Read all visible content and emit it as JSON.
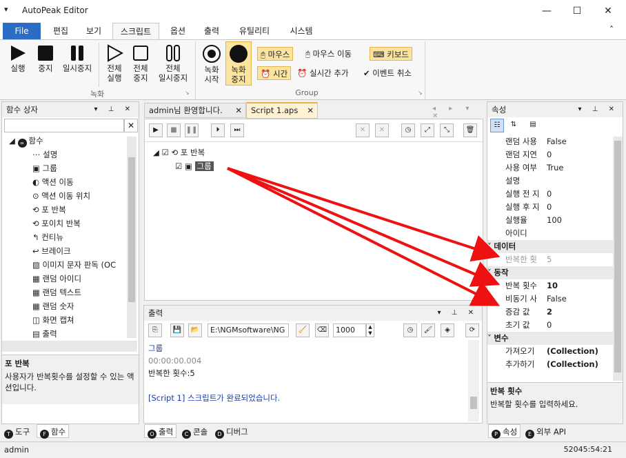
{
  "window": {
    "title": "AutoPeak Editor",
    "menu_icon": "▾",
    "min": "—",
    "max": "☐",
    "close": "✕"
  },
  "menu": {
    "file": "File",
    "tabs": [
      "편집",
      "보기",
      "스크립트",
      "옵션",
      "출력",
      "유틸리티",
      "시스템"
    ],
    "collapse": "˄"
  },
  "ribbon": {
    "run": "실행",
    "stop": "중지",
    "pause": "일시중지",
    "run_all": [
      "전체",
      "실행"
    ],
    "stop_all": [
      "전체",
      "중지"
    ],
    "pause_all": [
      "전체",
      "일시중지"
    ],
    "group1": "녹화",
    "rec_start": [
      "녹화",
      "시작"
    ],
    "rec_stop": [
      "녹화",
      "중지"
    ],
    "mouse": "마우스",
    "mouse_move": "마우스 이동",
    "keyboard": "키보드",
    "time": "시간",
    "realtime": "실시간 추가",
    "event_cancel": "이벤트 취소",
    "group2": "Group"
  },
  "func_panel": {
    "title": "함수 상자",
    "root": "함수",
    "items": [
      "설명",
      "그룹",
      "액션 이동",
      "액션 이동 위치",
      "포 반복",
      "포이치 반복",
      "컨티뉴",
      "브레이크",
      "이미지 문자 판독 (OC",
      "랜덤 아이디",
      "랜덤 텍스트",
      "랜덤 숫자",
      "화면 캡쳐",
      "출력"
    ],
    "desc_title": "포 반복",
    "desc": "사용자가 반복횟수를 설정할 수 있는 액션입니다.",
    "tab_tool": "도구",
    "tab_func": "함수"
  },
  "doc": {
    "tab_welcome": "admin님 환영합니다.",
    "tab_script": "Script 1.aps",
    "tree_loop": "포 반복",
    "tree_group": "그룹"
  },
  "output": {
    "title": "출력",
    "path": "E:\\NGMsoftware\\NG",
    "count": "1000",
    "lines": [
      "그룹",
      "00:00:00.004",
      "반복한 횟수:5",
      "",
      "[Script 1] 스크립트가 완료되었습니다."
    ],
    "tab_output": "출력",
    "tab_console": "콘솔",
    "tab_debug": "디버그"
  },
  "props": {
    "title": "속성",
    "rows1": [
      {
        "k": "랜덤 사용",
        "v": "False"
      },
      {
        "k": "랜덤 지연",
        "v": "0"
      },
      {
        "k": "사용 여부",
        "v": "True"
      },
      {
        "k": "설명",
        "v": ""
      },
      {
        "k": "실행 전 지",
        "v": "0"
      },
      {
        "k": "실행 후 지",
        "v": "0"
      },
      {
        "k": "실행율",
        "v": "100"
      },
      {
        "k": "아이디",
        "v": ""
      }
    ],
    "cat_data": "데이터",
    "data_rows": [
      {
        "k": "반복한 횟",
        "v": "5"
      }
    ],
    "cat_action": "동작",
    "action_rows": [
      {
        "k": "반복 횟수",
        "v": "10"
      },
      {
        "k": "비동기 사",
        "v": "False"
      },
      {
        "k": "증감 값",
        "v": "2"
      },
      {
        "k": "초기 값",
        "v": "0"
      }
    ],
    "cat_var": "변수",
    "var_rows": [
      {
        "k": "가져오기",
        "v": "(Collection)"
      },
      {
        "k": "추가하기",
        "v": "(Collection)"
      }
    ],
    "desc_title": "반복 횟수",
    "desc": "반복할 횟수를 입력하세요.",
    "tab_props": "속성",
    "tab_api": "외부 API"
  },
  "status": {
    "user": "admin",
    "time": "52045:54:21"
  },
  "colors": {
    "accent": "#2b6cc4",
    "arrow": "#ee1111",
    "highlight": "#fbe3a0"
  }
}
